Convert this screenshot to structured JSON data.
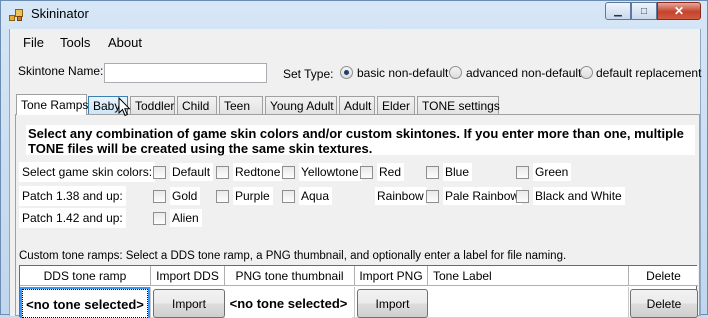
{
  "window": {
    "title": "Skininator"
  },
  "menu": [
    "File",
    "Tools",
    "About"
  ],
  "skintone": {
    "label": "Skintone Name:",
    "value": ""
  },
  "set_type": {
    "label": "Set Type:",
    "options": [
      "basic non-default",
      "advanced non-default",
      "default replacement"
    ],
    "selected": "basic non-default"
  },
  "tabs": [
    "Tone Ramps",
    "Baby",
    "Toddler",
    "Child",
    "Teen",
    "Young Adult",
    "Adult",
    "Elder",
    "TONE settings"
  ],
  "active_tab": "Tone Ramps",
  "hover_tab": "Baby",
  "info_text": "Select any combination of game skin colors and/or custom skintones. If you enter more than one, multiple TONE files will be created using the same skin textures.",
  "rows": {
    "game_colors_label": "Select game skin colors:",
    "patch138_label": "Patch 1.38 and up:",
    "patch142_label": "Patch 1.42 and up:",
    "game_colors": [
      "Default",
      "Redtone",
      "Yellowtone",
      "Red",
      "Blue",
      "Green"
    ],
    "patch138": [
      "Gold",
      "Purple",
      "Aqua",
      "Rainbow",
      "Pale Rainbow",
      "Black and White"
    ],
    "patch142": [
      "Alien"
    ]
  },
  "custom_label": "Custom tone ramps: Select a DDS tone ramp, a PNG thumbnail, and optionally enter a label for file naming.",
  "grid": {
    "headers": [
      "DDS tone ramp",
      "Import DDS",
      "PNG tone thumbnail",
      "Import PNG",
      "Tone Label",
      "Delete"
    ],
    "row": {
      "dds": "<no tone selected>",
      "import_dds": "Import",
      "png": "<no tone selected>",
      "import_png": "Import",
      "label": "",
      "delete": "Delete"
    }
  }
}
